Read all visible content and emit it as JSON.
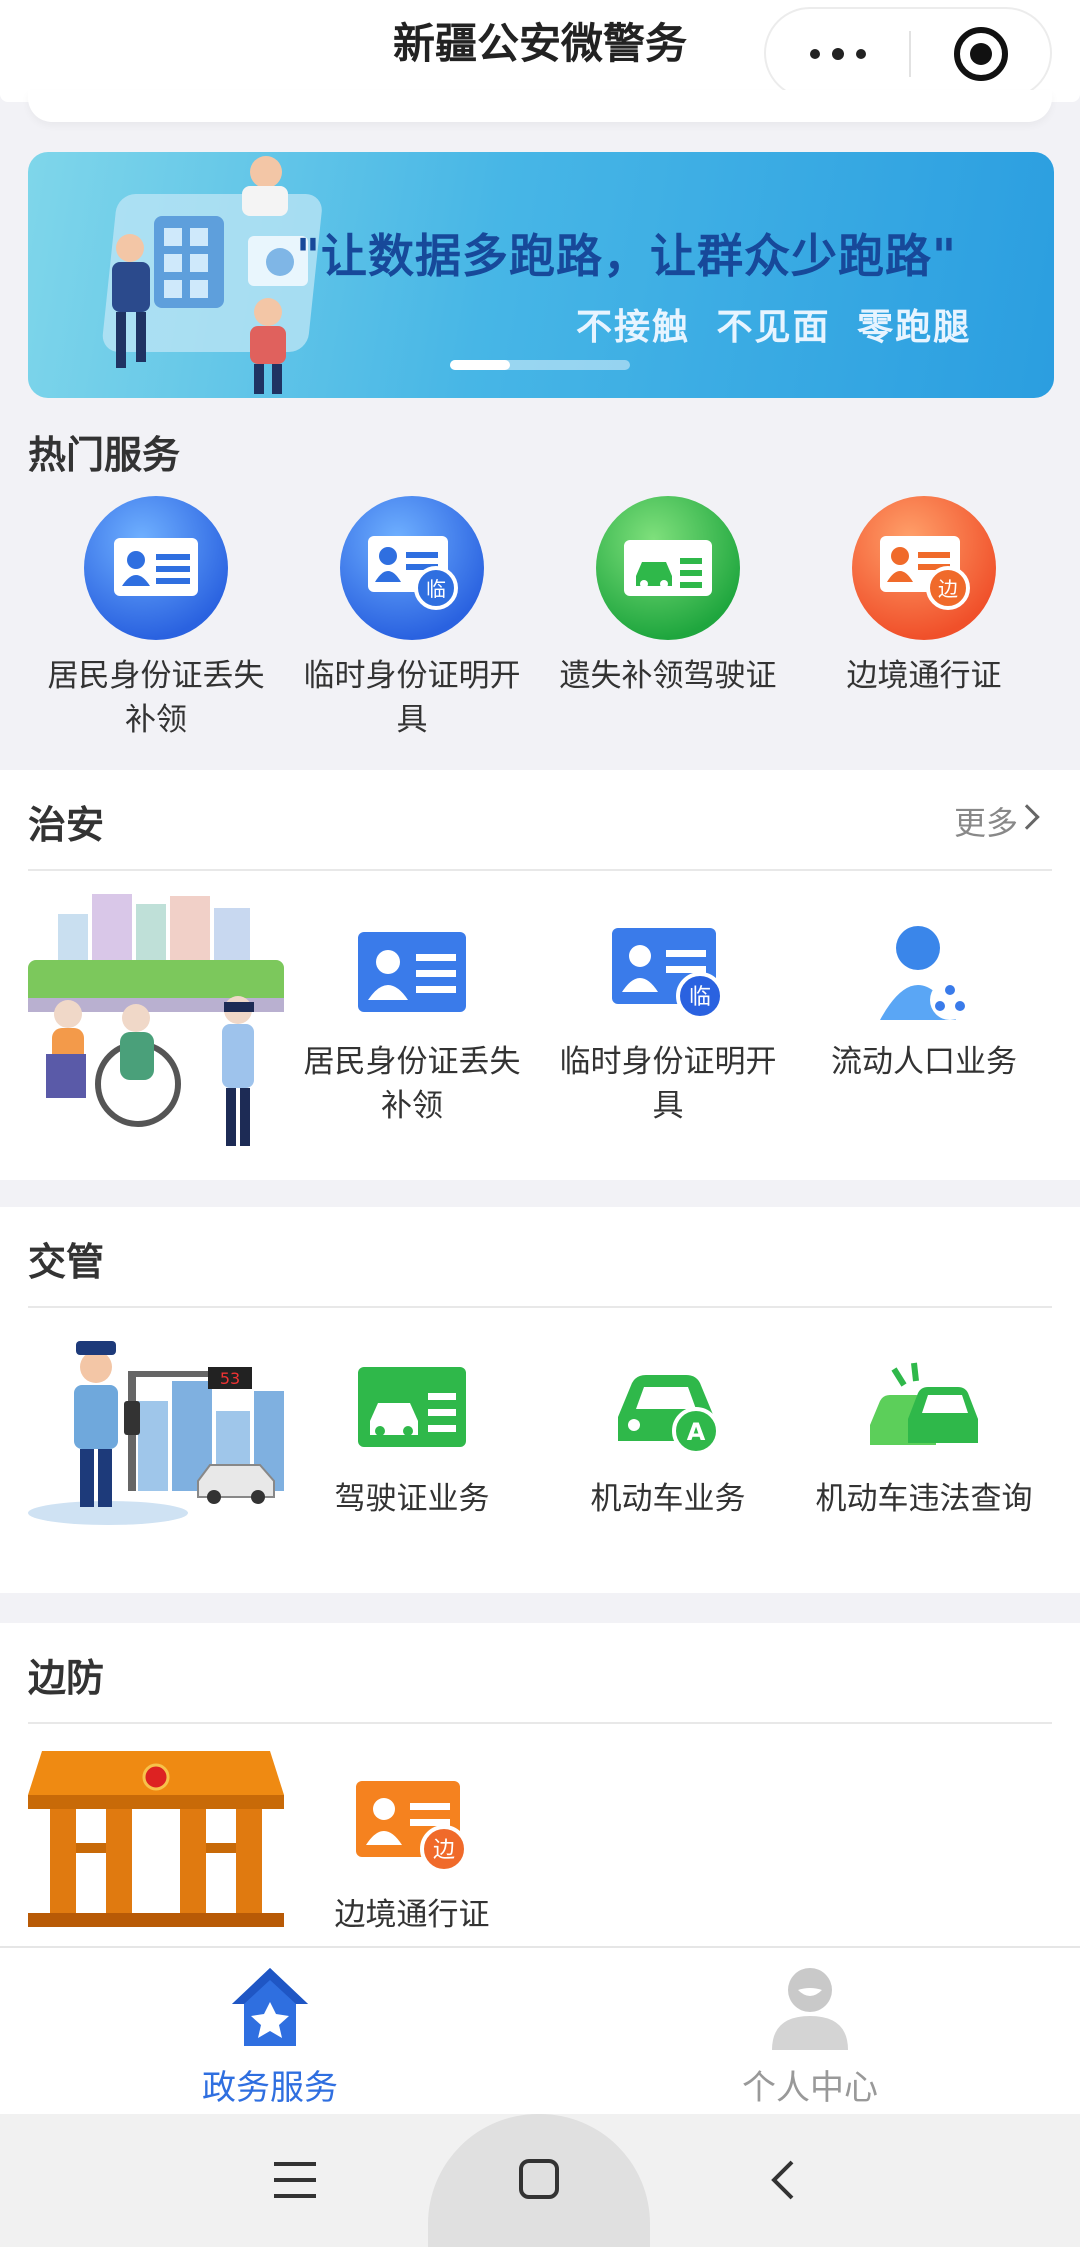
{
  "header": {
    "title": "新疆公安微警务"
  },
  "banner": {
    "slogan": "\"让数据多跑路，让群众少跑路\"",
    "subtitle": "不接触 不见面 零跑腿"
  },
  "hot": {
    "title": "热门服务",
    "items": [
      {
        "label": "居民身份证丢失补领",
        "icon": "id-card-icon",
        "color": "#3a7bea"
      },
      {
        "label": "临时身份证明开具",
        "icon": "temp-id-icon",
        "color": "#3a7bea"
      },
      {
        "label": "遗失补领驾驶证",
        "icon": "driver-license-icon",
        "color": "#2fb84a"
      },
      {
        "label": "边境通行证",
        "icon": "border-pass-icon",
        "color": "#f06a2a"
      }
    ]
  },
  "security": {
    "title": "治安",
    "more": "更多",
    "items": [
      {
        "label": "居民身份证丢失补领",
        "icon": "id-card-icon"
      },
      {
        "label": "临时身份证明开具",
        "icon": "temp-id-icon"
      },
      {
        "label": "流动人口业务",
        "icon": "floating-population-icon"
      }
    ]
  },
  "traffic": {
    "title": "交管",
    "items": [
      {
        "label": "驾驶证业务",
        "icon": "driver-license-icon"
      },
      {
        "label": "机动车业务",
        "icon": "vehicle-icon"
      },
      {
        "label": "机动车违法查询",
        "icon": "violation-query-icon"
      }
    ]
  },
  "border": {
    "title": "边防",
    "items": [
      {
        "label": "边境通行证",
        "icon": "border-pass-icon"
      }
    ]
  },
  "tabbar": {
    "tabs": [
      {
        "label": "政务服务",
        "active": true,
        "icon": "home-star-icon"
      },
      {
        "label": "个人中心",
        "active": false,
        "icon": "person-icon"
      }
    ]
  },
  "colors": {
    "accent": "#2f6fe0",
    "green": "#2fb84a",
    "orange": "#f06a2a"
  }
}
